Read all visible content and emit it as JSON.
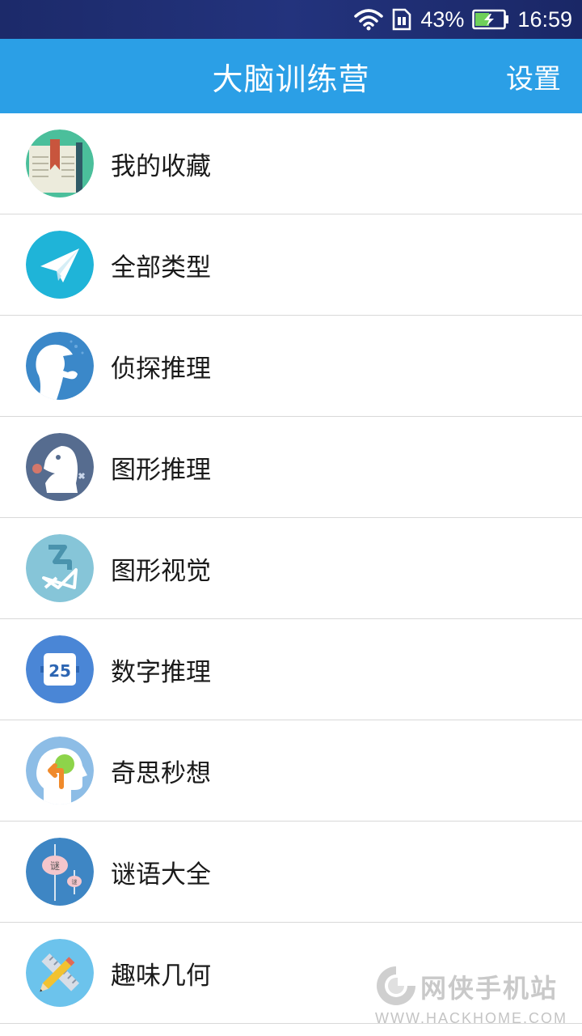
{
  "status_bar": {
    "battery_percent": "43%",
    "time": "16:59",
    "icons": [
      "wifi-icon",
      "sim-card-icon",
      "battery-charging-icon"
    ]
  },
  "app_bar": {
    "title": "大脑训练营",
    "settings_label": "设置",
    "color": "#2b9fe6"
  },
  "menu": {
    "items": [
      {
        "label": "我的收藏",
        "icon": "bookmark-book-icon",
        "color": "#4bbf9b"
      },
      {
        "label": "全部类型",
        "icon": "paper-plane-icon",
        "color": "#1fb4d8"
      },
      {
        "label": "侦探推理",
        "icon": "detective-silhouette-icon",
        "color": "#3b88c9"
      },
      {
        "label": "图形推理",
        "icon": "chess-knight-icon",
        "color": "#566c8f"
      },
      {
        "label": "图形视觉",
        "icon": "shape-puzzle-icon",
        "color": "#86c5d8"
      },
      {
        "label": "数字推理",
        "icon": "number-block-icon",
        "color": "#4a86d6"
      },
      {
        "label": "奇思秒想",
        "icon": "head-idea-icon",
        "color": "#8dbde6"
      },
      {
        "label": "谜语大全",
        "icon": "riddle-lantern-icon",
        "color": "#3e86c4"
      },
      {
        "label": "趣味几何",
        "icon": "ruler-pencil-icon",
        "color": "#6cc3ec"
      }
    ]
  },
  "watermark": {
    "brand_cn": "网侠手机站",
    "brand_url": "WWW.HACKHOME.COM"
  }
}
